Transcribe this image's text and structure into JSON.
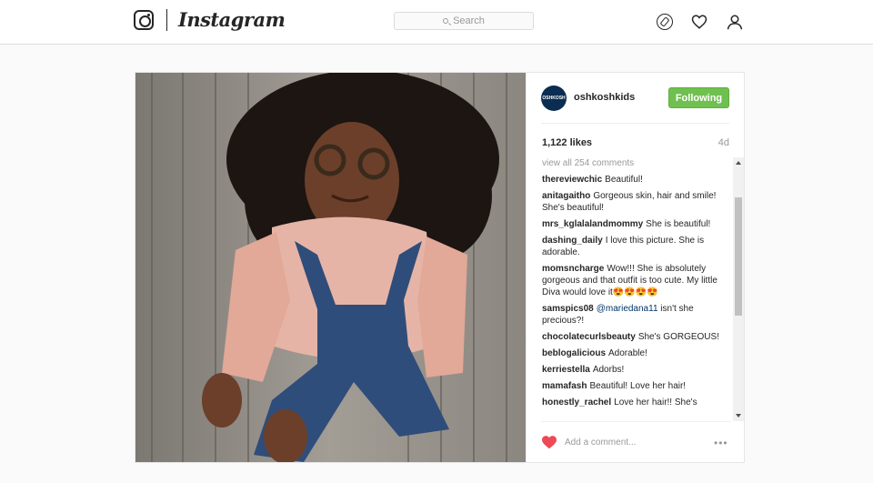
{
  "nav": {
    "wordmark": "Instagram",
    "search_placeholder": "Search",
    "icons": [
      "instagram-logo-icon",
      "search-icon",
      "explore-compass-icon",
      "heart-icon",
      "profile-icon"
    ]
  },
  "post": {
    "account": "oshkoshkids",
    "avatar_text": "OSHKOSH",
    "follow_label": "Following",
    "likes": "1,122 likes",
    "age": "4d",
    "view_all": "view all 254 comments",
    "comments": [
      {
        "user": "thereviewchic",
        "text": "Beautiful!"
      },
      {
        "user": "anitagaitho",
        "text": "Gorgeous skin, hair and smile! She's beautiful!"
      },
      {
        "user": "mrs_kglalalandmommy",
        "text": "She is beautiful!"
      },
      {
        "user": "dashing_daily",
        "text": "I love this picture. She is adorable."
      },
      {
        "user": "momsncharge",
        "text": "Wow!!! She is absolutely gorgeous and that outfit is too cute. My little Diva would love it😍😍😍😍"
      },
      {
        "user": "samspics08",
        "mention": "@mariedana11",
        "text": " isn't she precious?!"
      },
      {
        "user": "chocolatecurlsbeauty",
        "text": "She's GORGEOUS!"
      },
      {
        "user": "beblogalicious",
        "text": "Adorable!"
      },
      {
        "user": "kerriestella",
        "text": "Adorbs!"
      },
      {
        "user": "mamafash",
        "text": "Beautiful! Love her hair!"
      },
      {
        "user": "honestly_rachel",
        "text": "Love her hair!! She's"
      }
    ],
    "add_comment_placeholder": "Add a comment...",
    "like_color": "#ed4956",
    "follow_color": "#70c050"
  }
}
